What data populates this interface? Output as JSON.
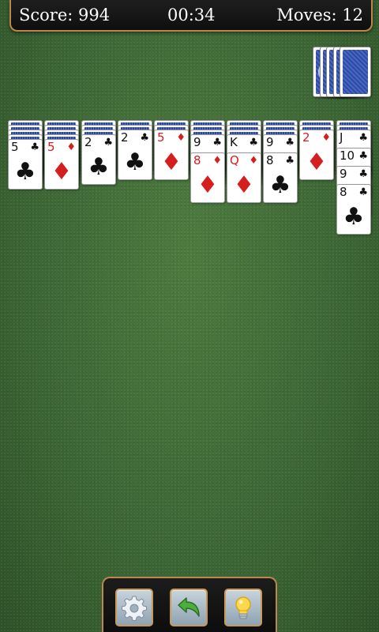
{
  "status": {
    "score": "Score: 994",
    "time": "00:34",
    "moves": "Moves: 12"
  },
  "stock": {
    "remaining_deals": 5
  },
  "tableau": [
    {
      "face_down": 4,
      "face_up": [
        {
          "rank": "5",
          "suit": "clubs"
        }
      ]
    },
    {
      "face_down": 4,
      "face_up": [
        {
          "rank": "5",
          "suit": "diamonds"
        }
      ]
    },
    {
      "face_down": 3,
      "face_up": [
        {
          "rank": "2",
          "suit": "clubs"
        }
      ]
    },
    {
      "face_down": 2,
      "face_up": [
        {
          "rank": "2",
          "suit": "clubs"
        }
      ]
    },
    {
      "face_down": 2,
      "face_up": [
        {
          "rank": "5",
          "suit": "diamonds"
        }
      ]
    },
    {
      "face_down": 3,
      "face_up": [
        {
          "rank": "9",
          "suit": "clubs"
        },
        {
          "rank": "8",
          "suit": "diamonds"
        }
      ]
    },
    {
      "face_down": 3,
      "face_up": [
        {
          "rank": "K",
          "suit": "clubs"
        },
        {
          "rank": "Q",
          "suit": "diamonds"
        }
      ]
    },
    {
      "face_down": 3,
      "face_up": [
        {
          "rank": "9",
          "suit": "clubs"
        },
        {
          "rank": "8",
          "suit": "clubs"
        }
      ]
    },
    {
      "face_down": 2,
      "face_up": [
        {
          "rank": "2",
          "suit": "diamonds"
        }
      ]
    },
    {
      "face_down": 2,
      "face_up": [
        {
          "rank": "J",
          "suit": "clubs"
        },
        {
          "rank": "10",
          "suit": "clubs"
        },
        {
          "rank": "9",
          "suit": "clubs"
        },
        {
          "rank": "8",
          "suit": "clubs"
        }
      ]
    }
  ],
  "suit_symbols": {
    "clubs": "♣",
    "diamonds": "♦"
  },
  "colors": {
    "table_felt": "#3f6a36",
    "red_suit": "#d51e1e",
    "black_suit": "#111111",
    "card_back": "#2f4ba1",
    "frame_accent": "#b9884e"
  },
  "toolbar": {
    "buttons": [
      {
        "name": "settings",
        "icon": "gear-icon"
      },
      {
        "name": "undo",
        "icon": "undo-arrow-icon"
      },
      {
        "name": "hint",
        "icon": "lightbulb-icon"
      }
    ]
  }
}
